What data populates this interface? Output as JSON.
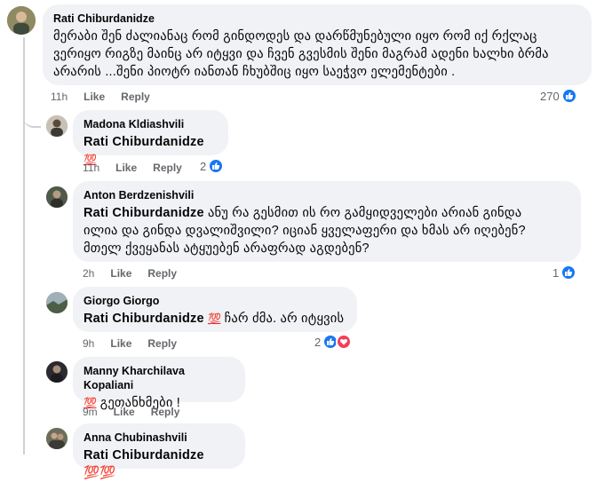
{
  "comments": [
    {
      "author": "Rati Chiburdanidze",
      "text": "მერაბი შენ ძალიანაც რომ გინდოდეს და დარწმუნებული იყო რომ იქ რქლაც ვერიყო რიგზე მაინც არ იტყვი და ჩვენ გვესმის შენი მაგრამ ადენი ხალხი ბრმა არარის ...შენი პიოტრ იანთან ჩხუბშიც იყო საეჭვო ელემენტები .",
      "time": "11h",
      "like_label": "Like",
      "reply_label": "Reply",
      "reaction_count": "270"
    },
    {
      "author": "Madona Kldiashvili",
      "mention": "Rati Chiburdanidze",
      "emoji": "💯",
      "text": "",
      "time": "11h",
      "like_label": "Like",
      "reply_label": "Reply",
      "reaction_count": "2"
    },
    {
      "author": "Anton Berdzenishvili",
      "mention": "Rati Chiburdanidze",
      "text_line1": "ანუ რა გესმით ის რო გამყიდველები არიან გინდა",
      "text_line2": "ილია და გინდა დვალიშვილი? იციან ყველაფერი და ხმას არ იღებენ?",
      "text_line3": "მთელ ქვეყანას ატყუებენ არაფრად აგდებენ?",
      "time": "2h",
      "like_label": "Like",
      "reply_label": "Reply",
      "reaction_count": "1"
    },
    {
      "author": "Giorgo Giorgo",
      "mention": "Rati Chiburdanidze",
      "emoji": "💯",
      "text": "ჩარ ძმა. არ იტყვის",
      "time": "9h",
      "like_label": "Like",
      "reply_label": "Reply",
      "reaction_count": "2"
    },
    {
      "author": "Manny Kharchilava Kopaliani",
      "emoji": "💯",
      "text": "გეთანხმები !",
      "time": "9m",
      "like_label": "Like",
      "reply_label": "Reply"
    },
    {
      "author": "Anna Chubinashvili",
      "partial_text": "Rati Chiburdanidze 💯💯"
    }
  ],
  "colors": {
    "bubble": "#f0f2f5",
    "meta": "#65676b",
    "like_blue": "#1877f2",
    "love_red": "#f33e58",
    "thread_line": "#ced0d4"
  }
}
